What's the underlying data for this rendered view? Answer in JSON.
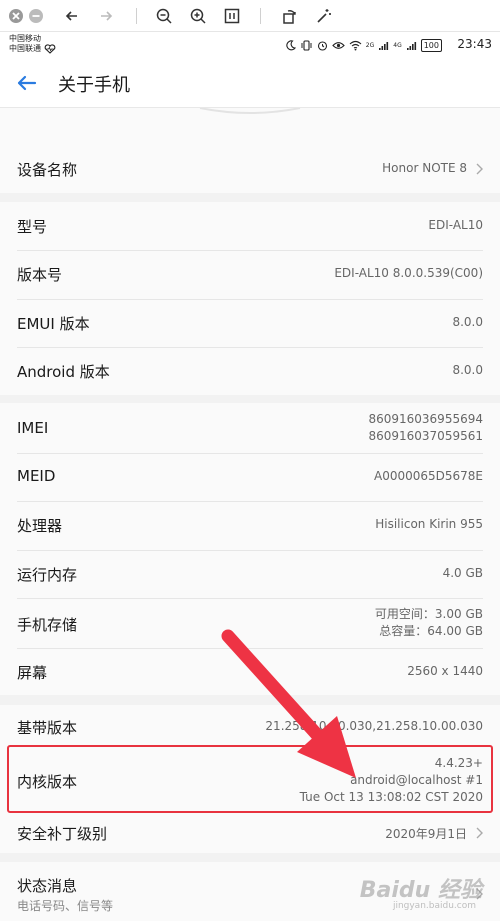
{
  "viewer": {
    "icons": [
      "close-icon",
      "cancel-icon",
      "back-arrow-icon",
      "forward-arrow-icon",
      "zoom-out-icon",
      "zoom-in-icon",
      "fit-screen-icon",
      "rotate-icon",
      "magic-wand-icon"
    ]
  },
  "status": {
    "carrier1": "中国移动",
    "carrier2": "中国联通",
    "net1": "2G",
    "net2": "4G",
    "battery": "100",
    "time": "23:43"
  },
  "header": {
    "title": "关于手机"
  },
  "rows": {
    "device_name": {
      "label": "设备名称",
      "value": "Honor NOTE 8"
    },
    "model": {
      "label": "型号",
      "value": "EDI-AL10"
    },
    "build": {
      "label": "版本号",
      "value": "EDI-AL10 8.0.0.539(C00)"
    },
    "emui": {
      "label": "EMUI 版本",
      "value": "8.0.0"
    },
    "android": {
      "label": "Android 版本",
      "value": "8.0.0"
    },
    "imei": {
      "label": "IMEI",
      "value1": "860916036955694",
      "value2": "860916037059561"
    },
    "meid": {
      "label": "MEID",
      "value": "A0000065D5678E"
    },
    "processor": {
      "label": "处理器",
      "value": "Hisilicon Kirin 955"
    },
    "ram": {
      "label": "运行内存",
      "value": "4.0 GB"
    },
    "storage": {
      "label": "手机存储",
      "value1": "可用空间：3.00  GB",
      "value2": "总容量：64.00  GB"
    },
    "screen": {
      "label": "屏幕",
      "value": "2560 x 1440"
    },
    "baseband": {
      "label": "基带版本",
      "value": "21.258.10.00.030,21.258.10.00.030"
    },
    "kernel": {
      "label": "内核版本",
      "value1": "4.4.23+",
      "value2": "android@localhost #1",
      "value3": "Tue Oct 13 13:08:02 CST 2020"
    },
    "security_patch": {
      "label": "安全补丁级别",
      "value": "2020年9月1日"
    },
    "status_info": {
      "label": "状态消息",
      "sub": "电话号码、信号等"
    }
  },
  "watermark": {
    "text": "Baidu 经验",
    "sub": "jingyan.baidu.com"
  },
  "colors": {
    "accent": "#2a7be0",
    "highlight": "#e8333f",
    "background": "#f2f2f2",
    "card": "#fafafa"
  }
}
